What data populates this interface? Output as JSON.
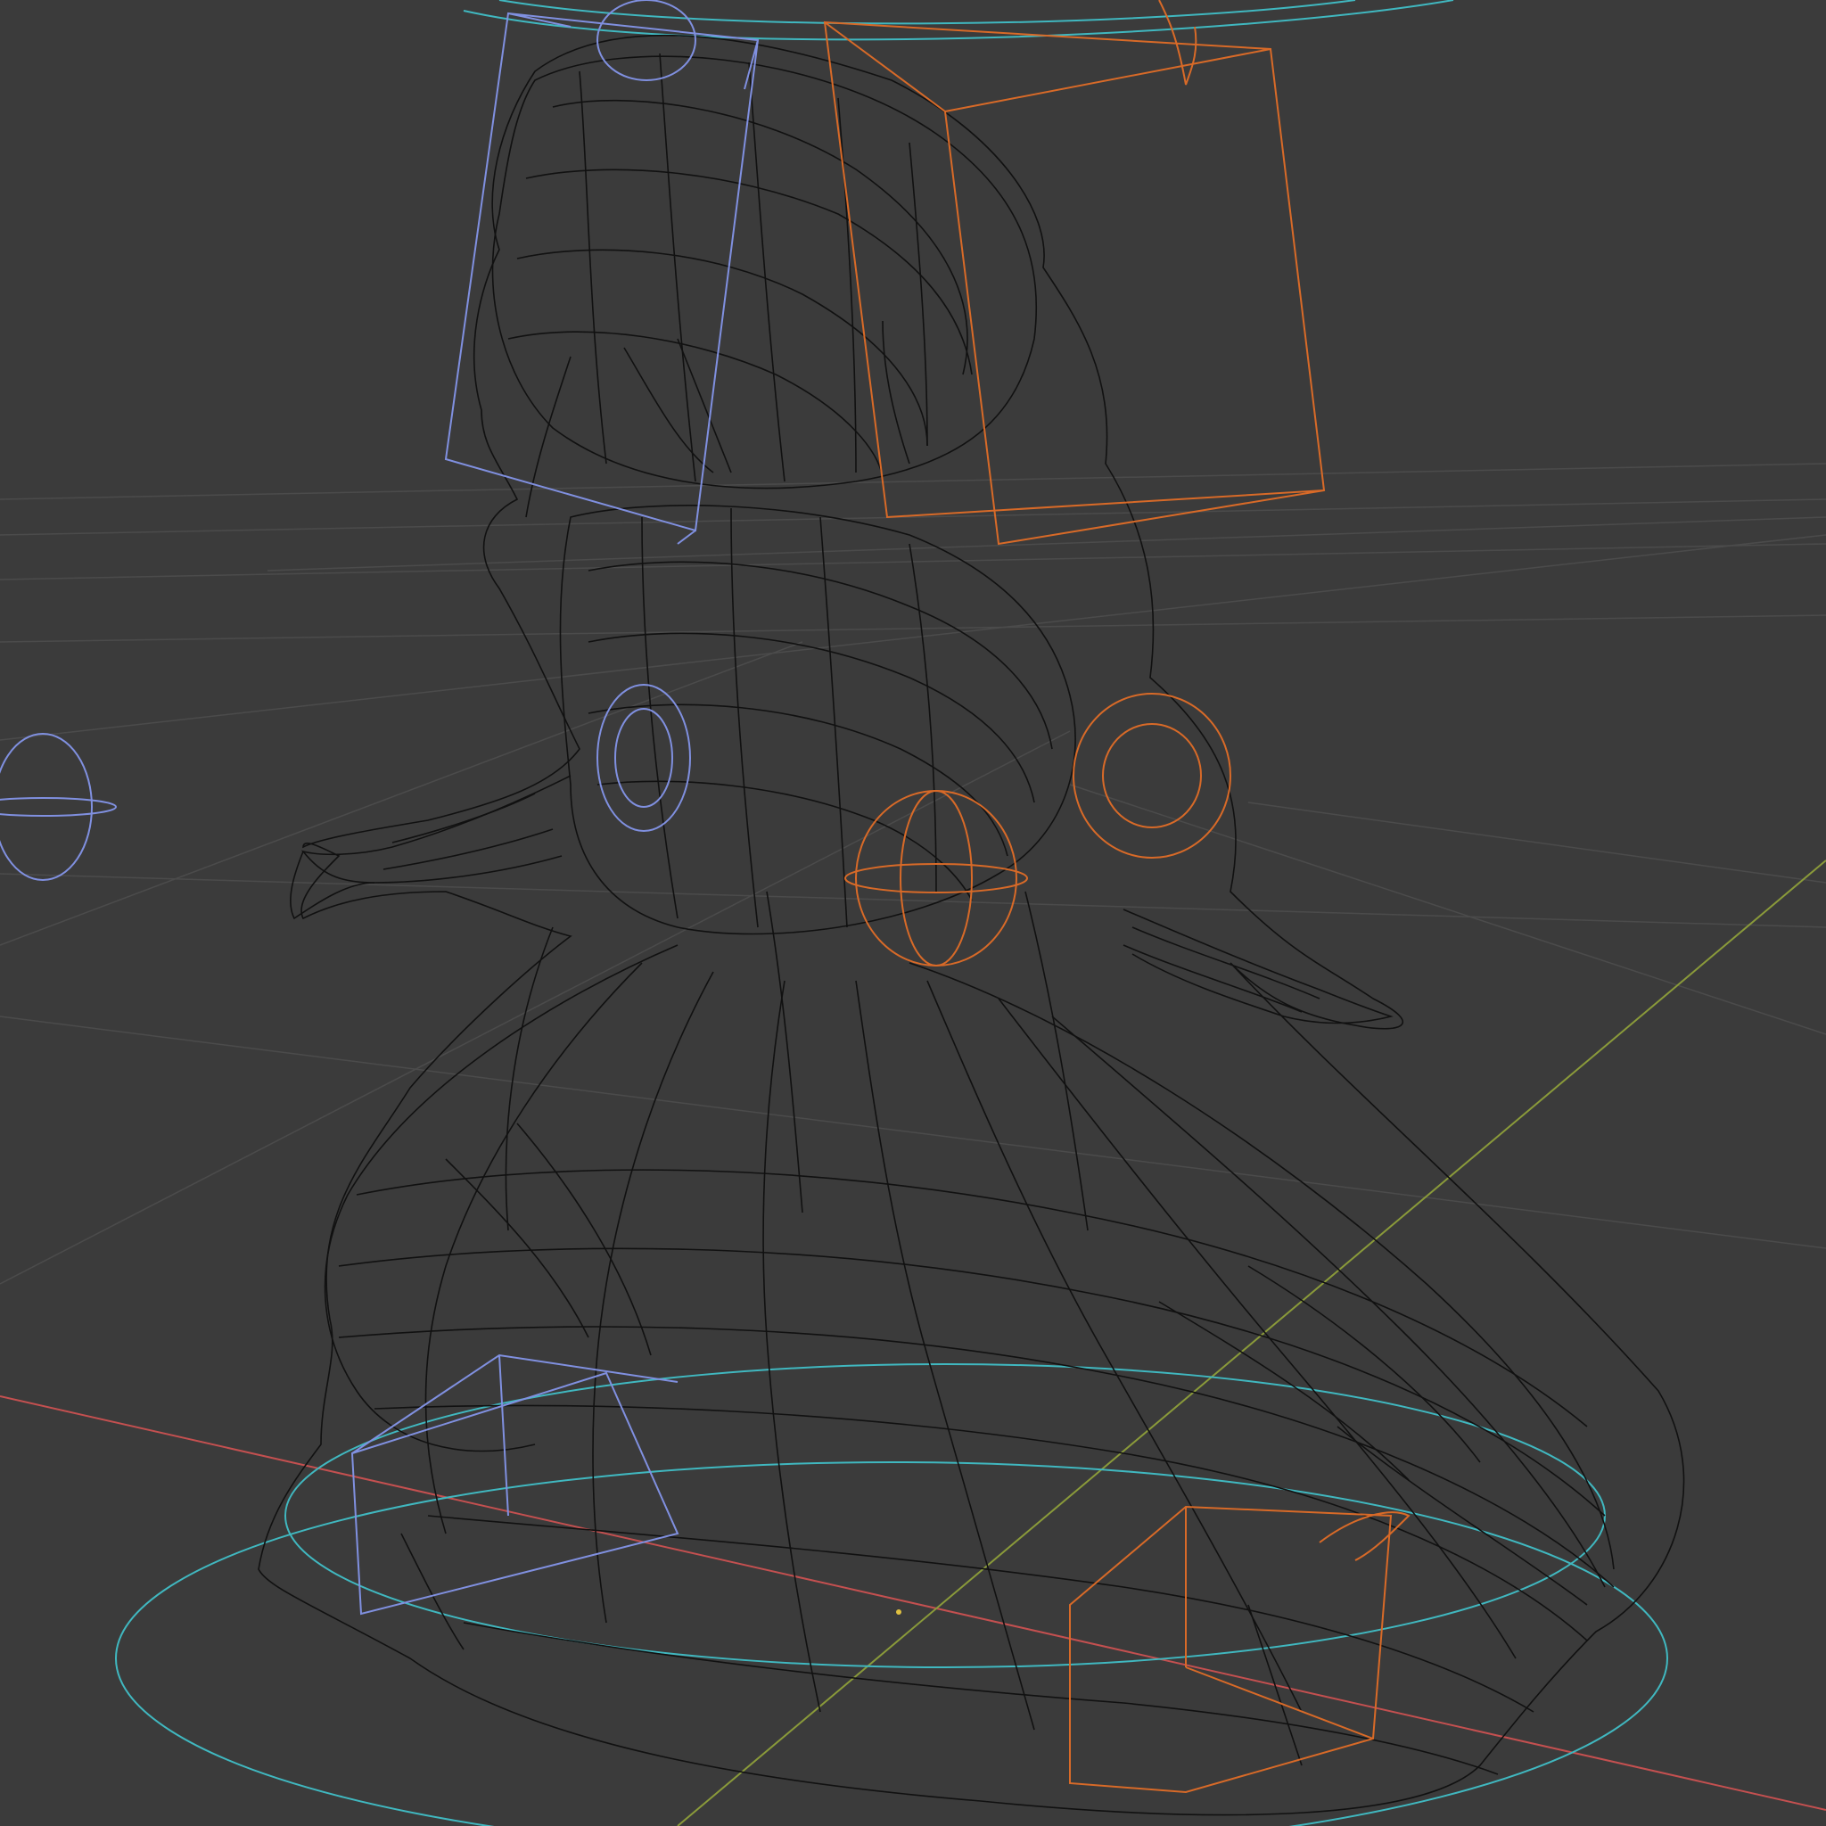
{
  "viewport": {
    "mode": "wireframe",
    "background_color": "#3b3b3b",
    "grid_color": "#505050",
    "x_axis_color": "#c45050",
    "y_axis_color": "#8a9a3a",
    "wireframe_color": "#111111",
    "controls": {
      "blue_color": "#8090e0",
      "orange_color": "#d86a28",
      "cyan_color": "#40b8c0"
    }
  }
}
